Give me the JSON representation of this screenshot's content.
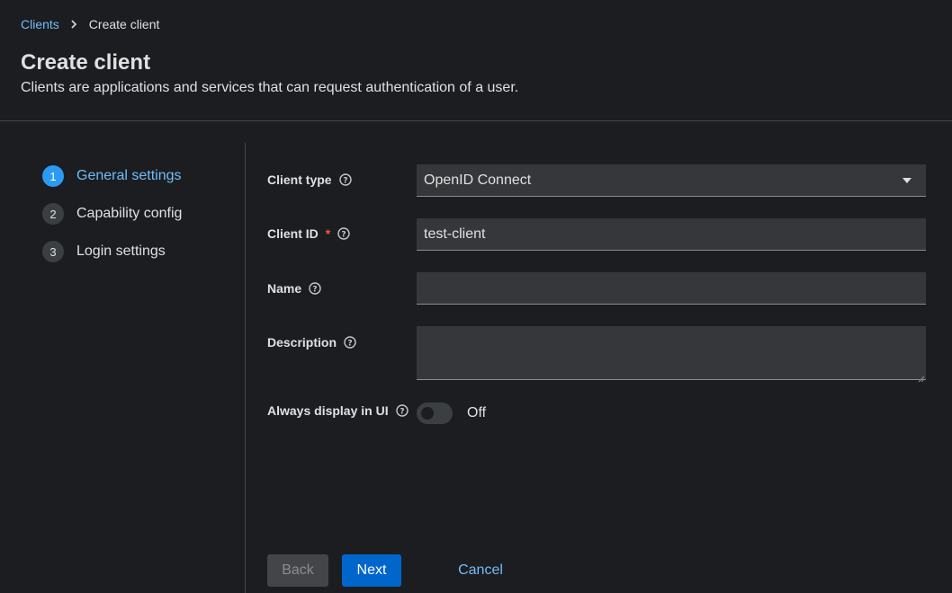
{
  "breadcrumb": {
    "parent": "Clients",
    "current": "Create client"
  },
  "page": {
    "title": "Create client",
    "subtitle": "Clients are applications and services that can request authentication of a user."
  },
  "steps": [
    {
      "number": "1",
      "label": "General settings",
      "active": true
    },
    {
      "number": "2",
      "label": "Capability config",
      "active": false
    },
    {
      "number": "3",
      "label": "Login settings",
      "active": false
    }
  ],
  "form": {
    "client_type": {
      "label": "Client type",
      "value": "OpenID Connect"
    },
    "client_id": {
      "label": "Client ID",
      "required_mark": "*",
      "value": "test-client"
    },
    "name": {
      "label": "Name",
      "value": ""
    },
    "description": {
      "label": "Description",
      "value": ""
    },
    "always_display": {
      "label": "Always display in UI",
      "state": "Off"
    }
  },
  "buttons": {
    "back": "Back",
    "next": "Next",
    "cancel": "Cancel"
  },
  "colors": {
    "background": "#1b1d21",
    "link": "#73bcf7",
    "active_step": "#2b9af3",
    "primary_button": "#0066cc",
    "required": "#fe5142"
  },
  "icons": {
    "help": "question-circle-icon",
    "separator": "chevron-right-icon",
    "dropdown": "caret-down-icon"
  }
}
